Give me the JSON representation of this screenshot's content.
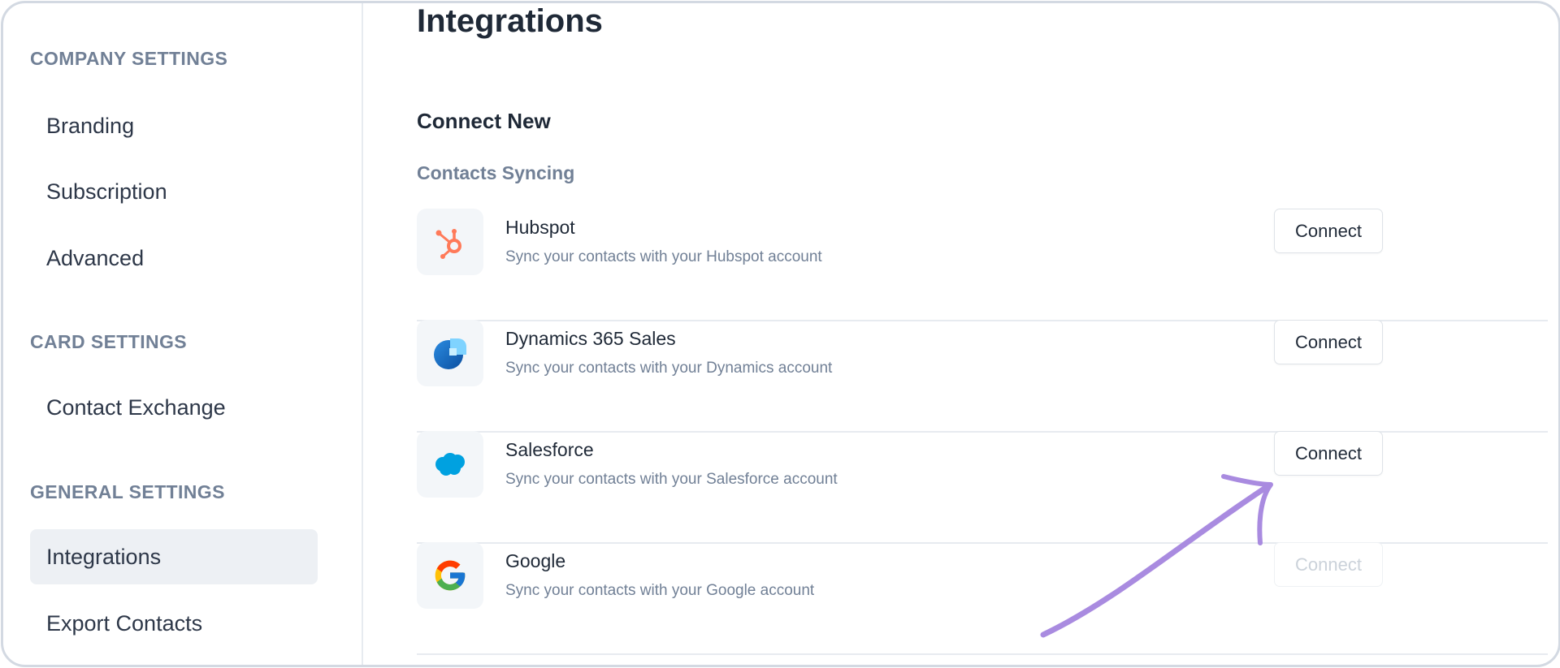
{
  "sidebar": {
    "sections": [
      {
        "title": "COMPANY SETTINGS",
        "items": [
          {
            "label": "Branding"
          },
          {
            "label": "Subscription"
          },
          {
            "label": "Advanced"
          }
        ]
      },
      {
        "title": "CARD SETTINGS",
        "items": [
          {
            "label": "Contact Exchange"
          }
        ]
      },
      {
        "title": "GENERAL SETTINGS",
        "items": [
          {
            "label": "Integrations",
            "active": true
          },
          {
            "label": "Export Contacts"
          }
        ]
      }
    ]
  },
  "main": {
    "title": "Integrations",
    "section_heading": "Connect New",
    "subsection_heading": "Contacts Syncing",
    "integrations": [
      {
        "name": "Hubspot",
        "description": "Sync your contacts with your Hubspot account",
        "button": "Connect",
        "icon": "hubspot-icon",
        "enabled": true
      },
      {
        "name": "Dynamics 365 Sales",
        "description": "Sync your contacts with your Dynamics account",
        "button": "Connect",
        "icon": "dynamics-icon",
        "enabled": true
      },
      {
        "name": "Salesforce",
        "description": "Sync your contacts with your Salesforce account",
        "button": "Connect",
        "icon": "salesforce-icon",
        "enabled": true
      },
      {
        "name": "Google",
        "description": "Sync your contacts with your Google account",
        "button": "Connect",
        "icon": "google-icon",
        "enabled": false
      }
    ]
  },
  "annotation": {
    "icon": "hand-drawn-arrow-icon",
    "color": "#a98be0"
  },
  "colors": {
    "hubspot": "#ff7a59",
    "salesforce": "#00a1e0",
    "dynamics": "#0b5cad",
    "muted": "#718096",
    "text": "#1f2937"
  }
}
